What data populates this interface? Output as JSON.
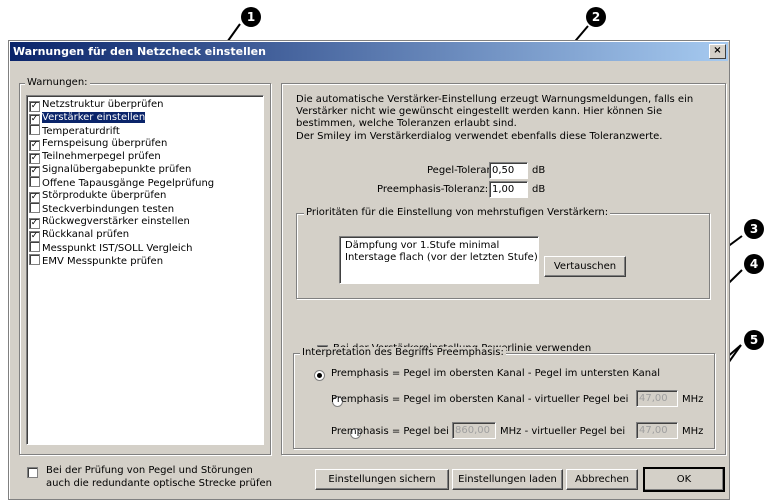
{
  "dialog": {
    "title": "Warnungen für den Netzcheck einstellen",
    "close_glyph": "×"
  },
  "warnings": {
    "group_label": "Warnungen:",
    "items": [
      {
        "label": "Netzstruktur überprüfen",
        "checked": true
      },
      {
        "label": "Verstärker einstellen",
        "checked": true,
        "selected": true
      },
      {
        "label": "Temperaturdrift",
        "checked": false
      },
      {
        "label": "Fernspeisung überprüfen",
        "checked": true
      },
      {
        "label": "Teilnehmerpegel prüfen",
        "checked": true
      },
      {
        "label": "Signalübergabepunkte prüfen",
        "checked": true
      },
      {
        "label": "Offene Tapausgänge Pegelprüfung",
        "checked": false
      },
      {
        "label": "Störprodukte überprüfen",
        "checked": true
      },
      {
        "label": "Steckverbindungen testen",
        "checked": false
      },
      {
        "label": "Rückwegverstärker einstellen",
        "checked": true
      },
      {
        "label": "Rückkanal prüfen",
        "checked": true
      },
      {
        "label": "Messpunkt IST/SOLL Vergleich",
        "checked": false
      },
      {
        "label": "EMV Messpunkte prüfen",
        "checked": false
      }
    ]
  },
  "redundant": {
    "line1": "Bei der Prüfung von Pegel und Störungen",
    "line2": "auch die redundante optische Strecke prüfen",
    "checked": false
  },
  "description": {
    "line1": "Die automatische Verstärker-Einstellung erzeugt Warnungsmeldungen, falls ein",
    "line2": "Verstärker nicht wie gewünscht eingestellt werden kann. Hier können Sie",
    "line3": "bestimmen, welche Toleranzen erlaubt sind.",
    "line4": "Der Smiley im Verstärkerdialog verwendet ebenfalls diese Toleranzwerte."
  },
  "tolerances": {
    "pegel_label": "Pegel-Toleranz:",
    "pegel_value": "0,50",
    "preemph_label": "Preemphasis-Toleranz:",
    "preemph_value": "1,00",
    "unit": "dB"
  },
  "priorities": {
    "group_label": "Prioritäten für die Einstellung von mehrstufigen Verstärkern:",
    "items": [
      "Dämpfung vor 1.Stufe minimal",
      "Interstage flach (vor der letzten Stufe)"
    ],
    "swap_button": "Vertauschen"
  },
  "powerline": {
    "label": "Bei der Verstärkereinstellung Powerlinie verwenden",
    "checked": false
  },
  "preemphasis": {
    "group_label": "Interpretation des Begriffs Preemphasis:",
    "opt1": "Premphasis = Pegel im obersten Kanal  -  Pegel im untersten Kanal",
    "opt2": "Premphasis = Pegel im obersten Kanal  -  virtueller Pegel bei",
    "opt2_value": "47,00",
    "opt3_a": "Premphasis = Pegel bei",
    "opt3_value1": "860,00",
    "opt3_b": "MHz  -  virtueller Pegel bei",
    "opt3_value2": "47,00",
    "mhz": "MHz",
    "selected": 1
  },
  "buttons": {
    "save": "Einstellungen sichern",
    "load": "Einstellungen laden",
    "cancel": "Abbrechen",
    "ok": "OK"
  },
  "callouts": [
    "1",
    "2",
    "3",
    "4",
    "5"
  ]
}
